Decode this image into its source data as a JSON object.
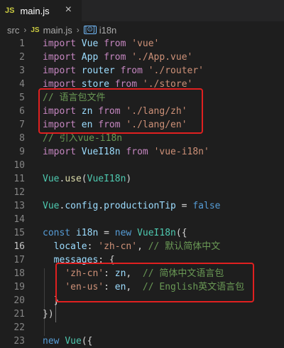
{
  "tab": {
    "badge": "JS",
    "name": "main.js",
    "close": "×"
  },
  "breadcrumb": {
    "folder": "src",
    "badge": "JS",
    "file": "main.js",
    "symbol_badge": "[⊙]",
    "symbol": "i18n",
    "sep": "›"
  },
  "lines": [
    {
      "n": "1",
      "t": [
        [
          "kw",
          "import"
        ],
        [
          "pr",
          " "
        ],
        [
          "va",
          "Vue"
        ],
        [
          "pr",
          " "
        ],
        [
          "kw",
          "from"
        ],
        [
          "pr",
          " "
        ],
        [
          "st",
          "'vue'"
        ]
      ]
    },
    {
      "n": "2",
      "t": [
        [
          "kw",
          "import"
        ],
        [
          "pr",
          " "
        ],
        [
          "va",
          "App"
        ],
        [
          "pr",
          " "
        ],
        [
          "kw",
          "from"
        ],
        [
          "pr",
          " "
        ],
        [
          "st",
          "'./App.vue'"
        ]
      ]
    },
    {
      "n": "3",
      "t": [
        [
          "kw",
          "import"
        ],
        [
          "pr",
          " "
        ],
        [
          "va",
          "router"
        ],
        [
          "pr",
          " "
        ],
        [
          "kw",
          "from"
        ],
        [
          "pr",
          " "
        ],
        [
          "st",
          "'./router'"
        ]
      ]
    },
    {
      "n": "4",
      "t": [
        [
          "kw",
          "import"
        ],
        [
          "pr",
          " "
        ],
        [
          "va",
          "store"
        ],
        [
          "pr",
          " "
        ],
        [
          "kw",
          "from"
        ],
        [
          "pr",
          " "
        ],
        [
          "st",
          "'./store'"
        ]
      ]
    },
    {
      "n": "5",
      "t": [
        [
          "cm",
          "// 语言包文件"
        ]
      ]
    },
    {
      "n": "6",
      "t": [
        [
          "kw",
          "import"
        ],
        [
          "pr",
          " "
        ],
        [
          "va",
          "zn"
        ],
        [
          "pr",
          " "
        ],
        [
          "kw",
          "from"
        ],
        [
          "pr",
          " "
        ],
        [
          "st",
          "'./lang/zh'"
        ]
      ]
    },
    {
      "n": "7",
      "t": [
        [
          "kw",
          "import"
        ],
        [
          "pr",
          " "
        ],
        [
          "va",
          "en"
        ],
        [
          "pr",
          " "
        ],
        [
          "kw",
          "from"
        ],
        [
          "pr",
          " "
        ],
        [
          "st",
          "'./lang/en'"
        ]
      ]
    },
    {
      "n": "8",
      "t": [
        [
          "cm",
          "// 引入vue-i18n"
        ]
      ]
    },
    {
      "n": "9",
      "t": [
        [
          "kw",
          "import"
        ],
        [
          "pr",
          " "
        ],
        [
          "va",
          "VueI18n"
        ],
        [
          "pr",
          " "
        ],
        [
          "kw",
          "from"
        ],
        [
          "pr",
          " "
        ],
        [
          "st",
          "'vue-i18n'"
        ]
      ]
    },
    {
      "n": "10",
      "t": []
    },
    {
      "n": "11",
      "t": [
        [
          "ty",
          "Vue"
        ],
        [
          "pr",
          "."
        ],
        [
          "fn",
          "use"
        ],
        [
          "pr",
          "("
        ],
        [
          "ty",
          "VueI18n"
        ],
        [
          "pr",
          ")"
        ]
      ]
    },
    {
      "n": "12",
      "t": []
    },
    {
      "n": "13",
      "t": [
        [
          "ty",
          "Vue"
        ],
        [
          "pr",
          "."
        ],
        [
          "va",
          "config"
        ],
        [
          "pr",
          "."
        ],
        [
          "va",
          "productionTip"
        ],
        [
          "pr",
          " = "
        ],
        [
          "bl",
          "false"
        ]
      ]
    },
    {
      "n": "14",
      "t": []
    },
    {
      "n": "15",
      "t": [
        [
          "bl",
          "const"
        ],
        [
          "pr",
          " "
        ],
        [
          "va",
          "i18n"
        ],
        [
          "pr",
          " = "
        ],
        [
          "bl",
          "new"
        ],
        [
          "pr",
          " "
        ],
        [
          "ty",
          "VueI18n"
        ],
        [
          "pr",
          "({"
        ]
      ]
    },
    {
      "n": "16",
      "t": [
        [
          "pr",
          "  "
        ],
        [
          "va",
          "locale"
        ],
        [
          "pr",
          ": "
        ],
        [
          "st",
          "'zh-cn'"
        ],
        [
          "pr",
          ", "
        ],
        [
          "cm",
          "// 默认简体中文"
        ]
      ],
      "active": true
    },
    {
      "n": "17",
      "t": [
        [
          "pr",
          "  "
        ],
        [
          "va",
          "messages"
        ],
        [
          "pr",
          ": {"
        ]
      ]
    },
    {
      "n": "18",
      "t": [
        [
          "pr",
          "    "
        ],
        [
          "st",
          "'zh-cn'"
        ],
        [
          "pr",
          ": "
        ],
        [
          "va",
          "zn"
        ],
        [
          "pr",
          ",  "
        ],
        [
          "cm",
          "// 简体中文语言包"
        ]
      ]
    },
    {
      "n": "19",
      "t": [
        [
          "pr",
          "    "
        ],
        [
          "st",
          "'en-us'"
        ],
        [
          "pr",
          ": "
        ],
        [
          "va",
          "en"
        ],
        [
          "pr",
          ",  "
        ],
        [
          "cm",
          "// English英文语言包"
        ]
      ]
    },
    {
      "n": "20",
      "t": [
        [
          "pr",
          "  }"
        ]
      ]
    },
    {
      "n": "21",
      "t": [
        [
          "pr",
          "})"
        ]
      ]
    },
    {
      "n": "22",
      "t": []
    },
    {
      "n": "23",
      "t": [
        [
          "bl",
          "new"
        ],
        [
          "pr",
          " "
        ],
        [
          "ty",
          "Vue"
        ],
        [
          "pr",
          "({"
        ]
      ]
    }
  ]
}
